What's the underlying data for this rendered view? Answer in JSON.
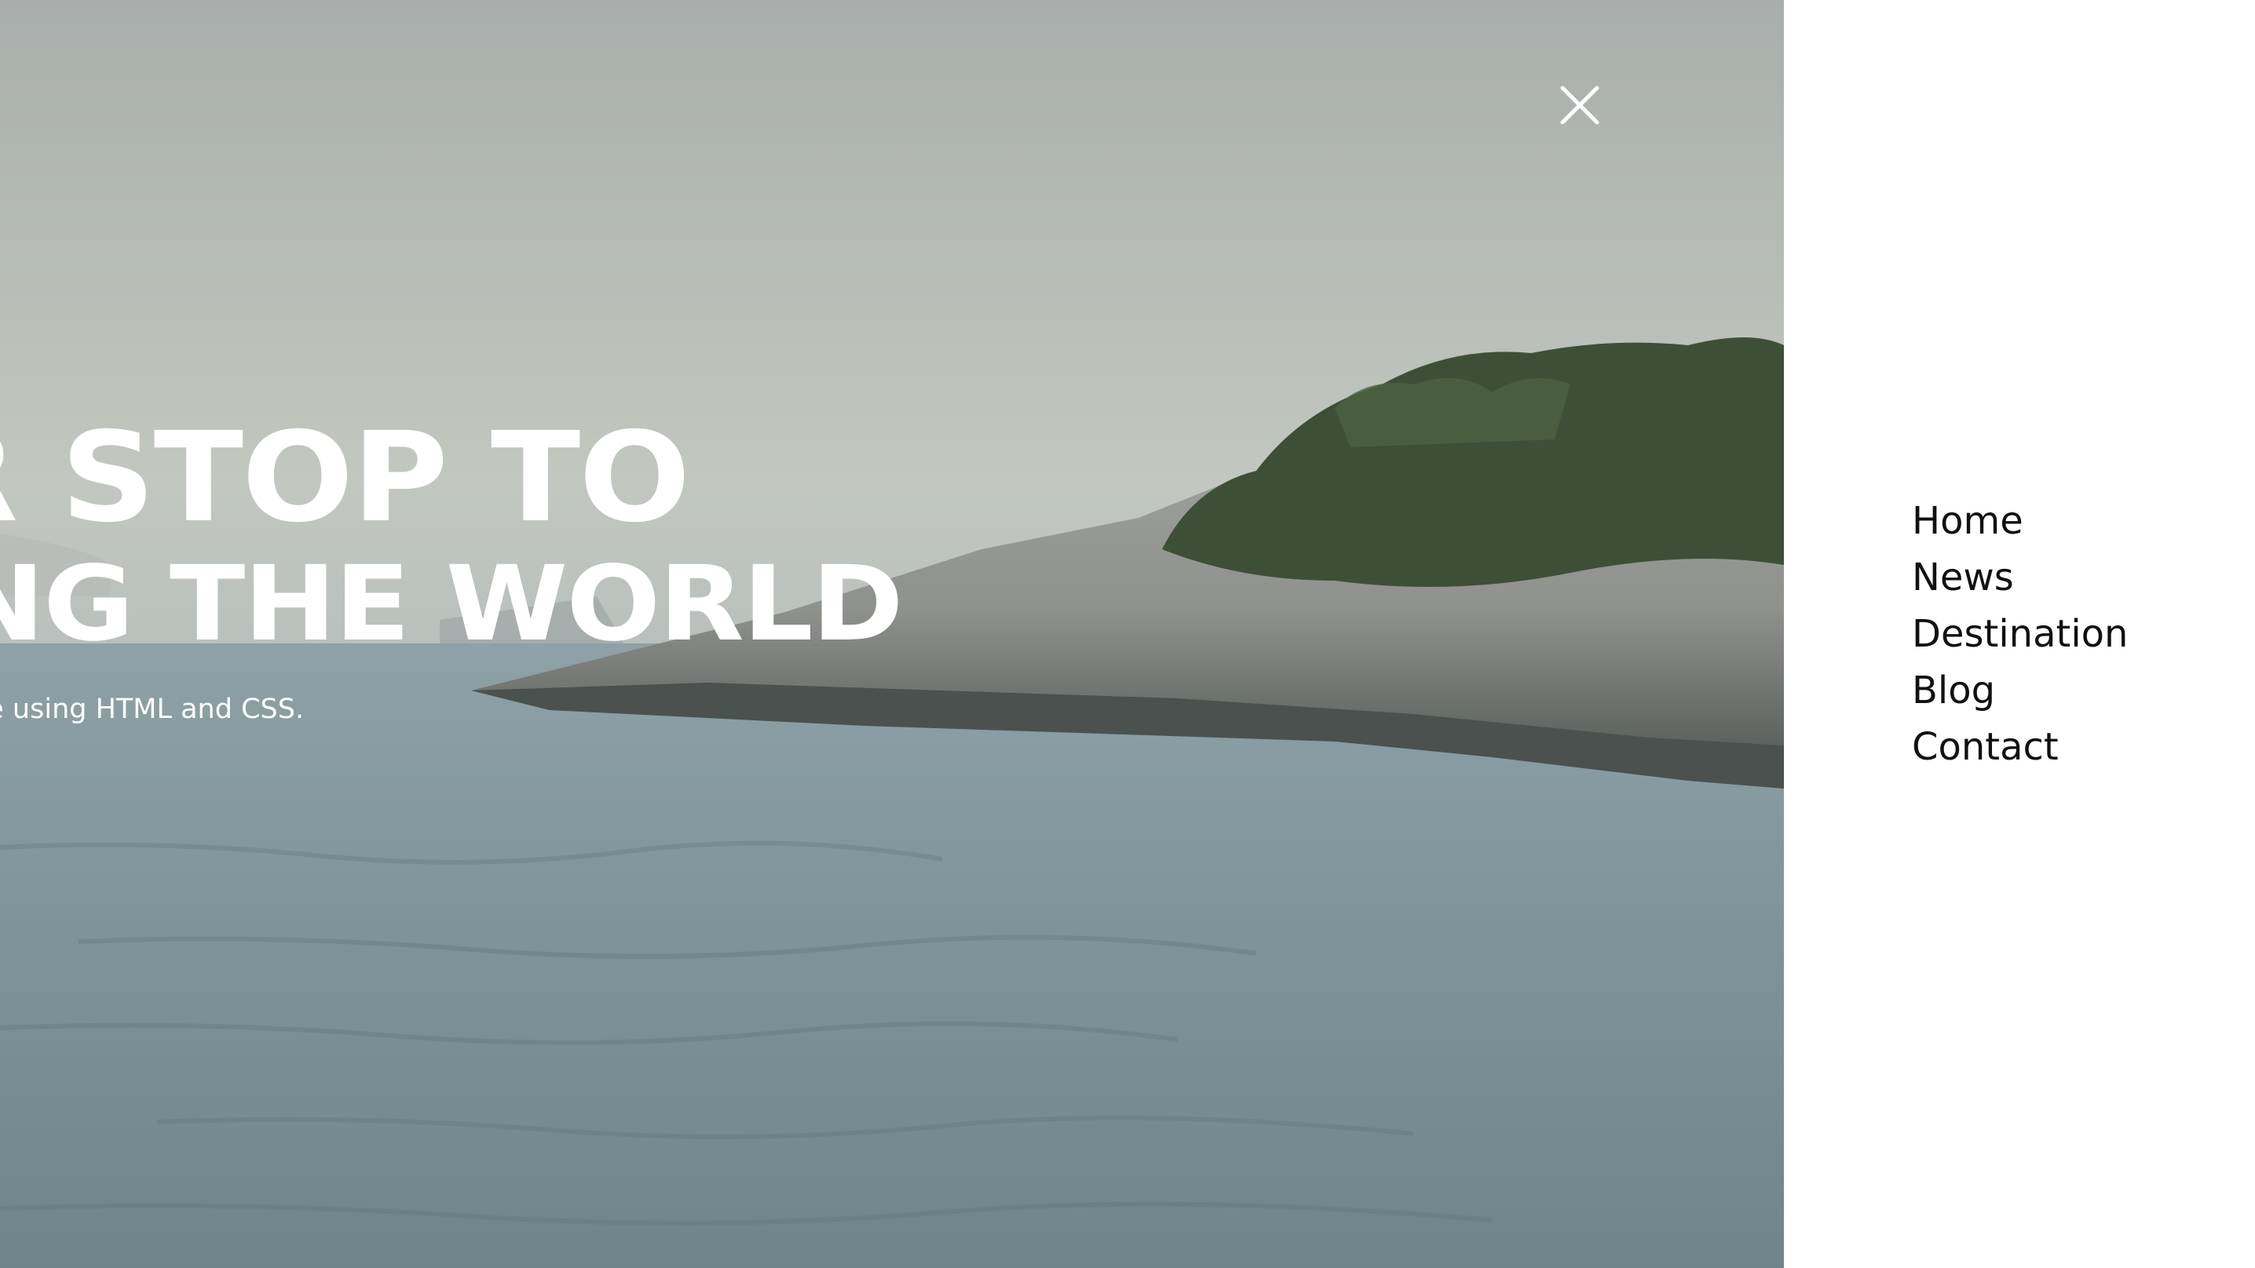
{
  "hero": {
    "headline_line1": "ER STOP TO",
    "headline_line2": "RING THE WORLD",
    "subtitle": "or travel site using HTML and CSS."
  },
  "close_icon": "close-icon",
  "nav": {
    "items": [
      {
        "label": "Home"
      },
      {
        "label": "News"
      },
      {
        "label": "Destination"
      },
      {
        "label": "Blog"
      },
      {
        "label": "Contact"
      }
    ]
  },
  "colors": {
    "nav_background": "#ffffff",
    "nav_text": "#111111",
    "hero_text": "#ffffff"
  }
}
